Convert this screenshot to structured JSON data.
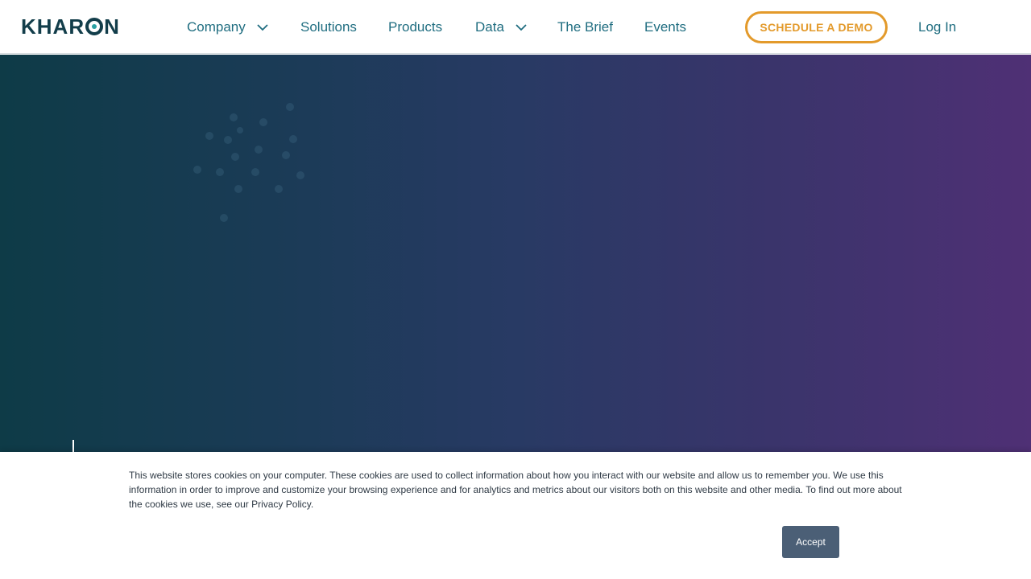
{
  "header": {
    "logo_text_before": "KHAR",
    "logo_text_after": "N",
    "nav": [
      {
        "label": "Company",
        "has_dropdown": true,
        "icon": "chevron-down-icon"
      },
      {
        "label": "Solutions",
        "has_dropdown": false
      },
      {
        "label": "Products",
        "has_dropdown": false
      },
      {
        "label": "Data",
        "has_dropdown": true,
        "icon": "chevron-down-icon"
      },
      {
        "label": "The Brief",
        "has_dropdown": false
      },
      {
        "label": "Events",
        "has_dropdown": false
      }
    ],
    "demo_button": "SCHEDULE A DEMO",
    "login": "Log In"
  },
  "colors": {
    "brand_dark": "#123d4a",
    "nav_text": "#1f6d80",
    "cta_orange": "#e39a2b",
    "hero_start": "#0e3b47",
    "hero_end": "#4f3075",
    "accept_bg": "#4b5f76"
  },
  "cookie_banner": {
    "text": "This website stores cookies on your computer. These cookies are used to collect information about how you interact with our website and allow us to remember you. We use this information in order to improve and customize your browsing experience and for analytics and metrics about our visitors both on this website and other media. To find out more about the cookies we use, see our Privacy Policy.",
    "accept_label": "Accept"
  }
}
